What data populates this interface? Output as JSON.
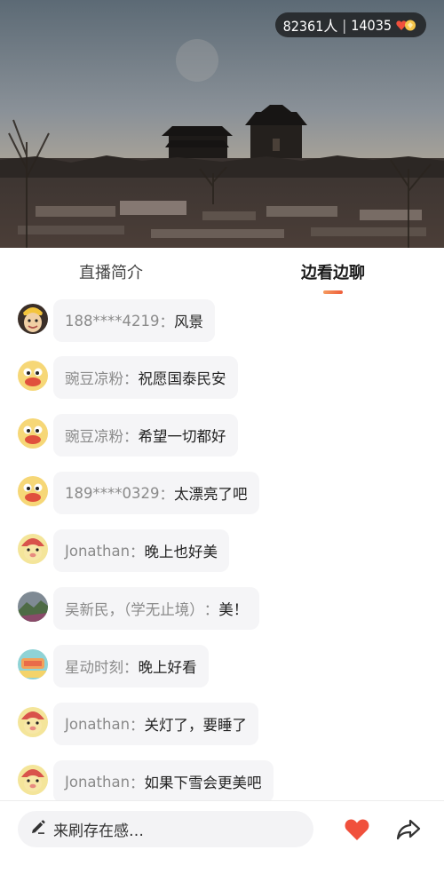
{
  "live": {
    "viewers": "82361人",
    "separator": "|",
    "likes": "14035"
  },
  "tabs": [
    {
      "label": "直播简介",
      "active": false
    },
    {
      "label": "边看边聊",
      "active": true
    }
  ],
  "messages": [
    {
      "user": "188****4219",
      "text": "风景",
      "avatar": "cartoon-boy-icon"
    },
    {
      "user": "豌豆凉粉",
      "text": "祝愿国泰民安",
      "avatar": "duck-icon"
    },
    {
      "user": "豌豆凉粉",
      "text": "希望一切都好",
      "avatar": "duck-icon"
    },
    {
      "user": "189****0329",
      "text": "太漂亮了吧",
      "avatar": "duck-icon"
    },
    {
      "user": "Jonathan",
      "text": "晚上也好美",
      "avatar": "pig-icon"
    },
    {
      "user": "吴新民，（学无止境）",
      "text": "美！",
      "avatar": "landscape-photo"
    },
    {
      "user": "星动时刻",
      "text": "晚上好看",
      "avatar": "poster-icon"
    },
    {
      "user": "Jonathan",
      "text": "关灯了，要睡了",
      "avatar": "pig-icon"
    },
    {
      "user": "Jonathan",
      "text": "如果下雪会更美吧",
      "avatar": "pig-icon"
    }
  ],
  "separator_colon": "：",
  "input": {
    "placeholder": "来刷存在感…"
  },
  "colors": {
    "accent": "#ee5d3a",
    "heart": "#f0503c",
    "bubble": "#f5f5f7"
  }
}
